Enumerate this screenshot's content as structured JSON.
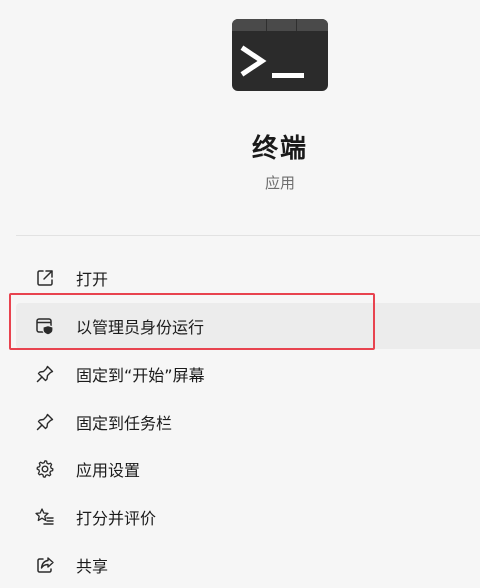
{
  "app": {
    "name": "终端",
    "type": "应用",
    "icon": "terminal-app-icon"
  },
  "menu": {
    "items": [
      {
        "label": "打开",
        "icon": "open-external-icon"
      },
      {
        "label": "以管理员身份运行",
        "icon": "run-as-admin-shield-icon"
      },
      {
        "label": "固定到“开始”屏幕",
        "icon": "pin-icon"
      },
      {
        "label": "固定到任务栏",
        "icon": "pin-icon"
      },
      {
        "label": "应用设置",
        "icon": "gear-icon"
      },
      {
        "label": "打分并评价",
        "icon": "star-list-icon"
      },
      {
        "label": "共享",
        "icon": "share-icon"
      }
    ]
  },
  "colors": {
    "background": "#f6f6f6",
    "highlight_border": "#e8434f",
    "hover_background": "#ececec",
    "icon_dark": "#2b2b2b"
  }
}
